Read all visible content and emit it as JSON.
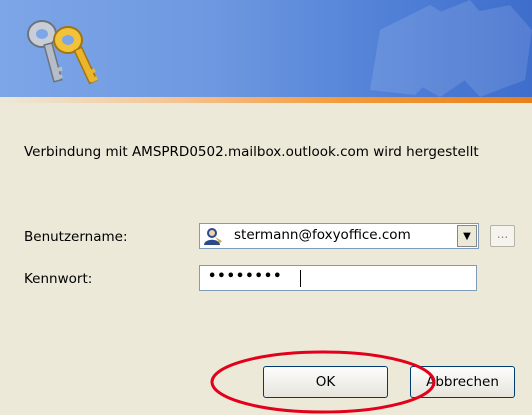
{
  "message": "Verbindung mit AMSPRD0502.mailbox.outlook.com wird hergestellt",
  "username": {
    "label": "Benutzername:",
    "value": "stermann@foxyoffice.com",
    "more_label": "..."
  },
  "password": {
    "label": "Kennwort:",
    "masked_value": "••••••••"
  },
  "buttons": {
    "ok": "OK",
    "cancel": "Abbrechen"
  },
  "icons": {
    "banner": "keys-icon",
    "user": "user-icon",
    "dropdown": "chevron-down-icon"
  },
  "colors": {
    "banner_blue": "#4f7fd6",
    "highlight_red": "#e3001b"
  }
}
